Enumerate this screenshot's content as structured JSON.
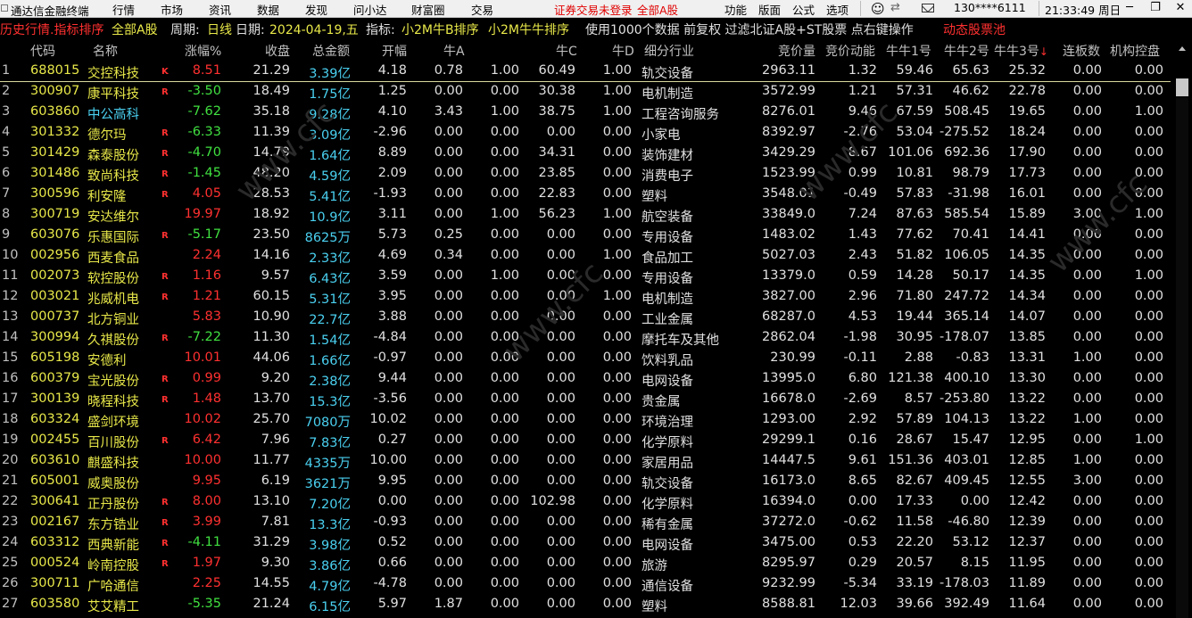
{
  "menubar": {
    "app_title": "通达信金融终端",
    "menus": [
      "行情",
      "市场",
      "资讯",
      "数据",
      "发现",
      "问小达",
      "财富圈",
      "交易"
    ],
    "trade_status": "证券交易未登录",
    "market": "全部A股",
    "right_menus": [
      "功能",
      "版面",
      "公式",
      "选项"
    ],
    "account": "130****6111",
    "clock": "21:33:49 周日",
    "win_minimize": "─",
    "win_restore": "❐",
    "win_close": "✕"
  },
  "infobar": {
    "mode": "历史行情.指标排序",
    "market": "全部A股",
    "period_label": "周期:",
    "period": "日线",
    "date_label": "日期:",
    "date": "2024-04-19,五",
    "indicator_label": "指标:",
    "indicator_b": "小2M牛B排序",
    "indicator_niu": "小2M牛牛排序",
    "data_setting": "使用1000个数据 前复权 过滤北证A股+ST股票 点右键操作",
    "pool": "动态股票池"
  },
  "columns": {
    "code": "代码",
    "name": "名称",
    "change": "涨幅%",
    "close": "收盘",
    "amount": "总金额",
    "open_pct": "开幅",
    "niu_a": "牛A",
    "niu_b": "",
    "niu_c": "牛C",
    "niu_d": "牛D",
    "industry": "细分行业",
    "bid_vol": "竞价量",
    "bid_mom": "竞价动能",
    "nn1": "牛牛1号",
    "nn2": "牛牛2号",
    "nn3": "牛牛3号",
    "sort_arrow": "↓",
    "streak": "连板数",
    "inst": "机构控盘"
  },
  "rows": [
    {
      "idx": "1",
      "code": "688015",
      "name": "交控科技",
      "badge": "K",
      "chg": "8.51",
      "close": "21.29",
      "amt": "3.39亿",
      "open": "4.18",
      "a": "0.78",
      "b": "1.00",
      "c": "60.49",
      "d": "1.00",
      "ind": "轨交设备",
      "bv": "2963.11",
      "bm": "1.32",
      "n1": "59.46",
      "n2": "65.63",
      "n3": "25.32",
      "lb": "0.00",
      "jg": "0.00"
    },
    {
      "idx": "2",
      "code": "300907",
      "name": "康平科技",
      "badge": "R",
      "chg": "-3.50",
      "close": "18.49",
      "amt": "1.75亿",
      "open": "1.25",
      "a": "0.00",
      "b": "0.00",
      "c": "30.38",
      "d": "1.00",
      "ind": "电机制造",
      "bv": "3572.99",
      "bm": "1.21",
      "n1": "57.31",
      "n2": "46.62",
      "n3": "22.78",
      "lb": "0.00",
      "jg": "0.00"
    },
    {
      "idx": "3",
      "code": "603860",
      "name": "中公高科",
      "badge": "",
      "chg": "-7.62",
      "close": "35.18",
      "amt": "9.28亿",
      "open": "4.10",
      "a": "3.43",
      "b": "1.00",
      "c": "38.75",
      "d": "1.00",
      "ind": "工程咨询服务",
      "bv": "8276.01",
      "bm": "9.46",
      "n1": "67.59",
      "n2": "508.45",
      "n3": "19.65",
      "lb": "0.00",
      "jg": "1.00"
    },
    {
      "idx": "4",
      "code": "301332",
      "name": "德尔玛",
      "badge": "R",
      "chg": "-6.33",
      "close": "11.39",
      "amt": "3.09亿",
      "open": "-2.96",
      "a": "0.00",
      "b": "0.00",
      "c": "0.00",
      "d": "0.00",
      "ind": "小家电",
      "bv": "8392.97",
      "bm": "-2.76",
      "n1": "53.04",
      "n2": "-275.52",
      "n3": "18.24",
      "lb": "0.00",
      "jg": "0.00"
    },
    {
      "idx": "5",
      "code": "301429",
      "name": "森泰股份",
      "badge": "R",
      "chg": "-4.70",
      "close": "14.79",
      "amt": "1.64亿",
      "open": "8.89",
      "a": "0.00",
      "b": "0.00",
      "c": "34.31",
      "d": "0.00",
      "ind": "装饰建材",
      "bv": "3429.29",
      "bm": "8.67",
      "n1": "101.06",
      "n2": "692.36",
      "n3": "17.90",
      "lb": "0.00",
      "jg": "0.00"
    },
    {
      "idx": "6",
      "code": "301486",
      "name": "致尚科技",
      "badge": "R",
      "chg": "-1.45",
      "close": "48.20",
      "amt": "4.59亿",
      "open": "2.09",
      "a": "0.00",
      "b": "0.00",
      "c": "23.85",
      "d": "0.00",
      "ind": "消费电子",
      "bv": "1523.99",
      "bm": "0.99",
      "n1": "10.81",
      "n2": "98.79",
      "n3": "17.73",
      "lb": "0.00",
      "jg": "0.00"
    },
    {
      "idx": "7",
      "code": "300596",
      "name": "利安隆",
      "badge": "R",
      "chg": "4.05",
      "close": "28.53",
      "amt": "5.41亿",
      "open": "-1.93",
      "a": "0.00",
      "b": "0.00",
      "c": "22.83",
      "d": "0.00",
      "ind": "塑料",
      "bv": "3548.01",
      "bm": "-0.49",
      "n1": "57.83",
      "n2": "-31.98",
      "n3": "16.01",
      "lb": "0.00",
      "jg": "0.00"
    },
    {
      "idx": "8",
      "code": "300719",
      "name": "安达维尔",
      "badge": "",
      "chg": "19.97",
      "close": "18.92",
      "amt": "10.9亿",
      "open": "3.11",
      "a": "0.00",
      "b": "1.00",
      "c": "56.23",
      "d": "1.00",
      "ind": "航空装备",
      "bv": "33849.0",
      "bm": "7.24",
      "n1": "87.63",
      "n2": "585.54",
      "n3": "15.89",
      "lb": "3.00",
      "jg": "1.00"
    },
    {
      "idx": "9",
      "code": "603076",
      "name": "乐惠国际",
      "badge": "R",
      "chg": "-5.17",
      "close": "23.50",
      "amt": "8625万",
      "open": "5.73",
      "a": "0.25",
      "b": "0.00",
      "c": "0.00",
      "d": "0.00",
      "ind": "专用设备",
      "bv": "1483.02",
      "bm": "1.43",
      "n1": "77.62",
      "n2": "70.41",
      "n3": "14.41",
      "lb": "0.00",
      "jg": "0.00"
    },
    {
      "idx": "10",
      "code": "002956",
      "name": "西麦食品",
      "badge": "",
      "chg": "2.24",
      "close": "14.16",
      "amt": "2.33亿",
      "open": "4.69",
      "a": "0.34",
      "b": "0.00",
      "c": "0.00",
      "d": "1.00",
      "ind": "食品加工",
      "bv": "5027.03",
      "bm": "2.43",
      "n1": "51.82",
      "n2": "106.05",
      "n3": "14.35",
      "lb": "0.00",
      "jg": "0.00"
    },
    {
      "idx": "11",
      "code": "002073",
      "name": "软控股份",
      "badge": "R",
      "chg": "1.16",
      "close": "9.57",
      "amt": "6.43亿",
      "open": "3.59",
      "a": "0.00",
      "b": "1.00",
      "c": "0.00",
      "d": "0.00",
      "ind": "专用设备",
      "bv": "13379.0",
      "bm": "0.59",
      "n1": "14.28",
      "n2": "50.17",
      "n3": "14.35",
      "lb": "0.00",
      "jg": "1.00"
    },
    {
      "idx": "12",
      "code": "003021",
      "name": "兆威机电",
      "badge": "R",
      "chg": "1.21",
      "close": "60.15",
      "amt": "5.31亿",
      "open": "3.95",
      "a": "0.00",
      "b": "0.00",
      "c": "0.00",
      "d": "1.00",
      "ind": "电机制造",
      "bv": "3827.00",
      "bm": "2.96",
      "n1": "71.80",
      "n2": "247.72",
      "n3": "14.34",
      "lb": "0.00",
      "jg": "0.00"
    },
    {
      "idx": "13",
      "code": "000737",
      "name": "北方铜业",
      "badge": "",
      "chg": "5.83",
      "close": "10.90",
      "amt": "22.7亿",
      "open": "3.88",
      "a": "0.00",
      "b": "0.00",
      "c": "0.00",
      "d": "0.00",
      "ind": "工业金属",
      "bv": "68287.0",
      "bm": "4.53",
      "n1": "19.44",
      "n2": "365.14",
      "n3": "14.07",
      "lb": "0.00",
      "jg": "0.00"
    },
    {
      "idx": "14",
      "code": "300994",
      "name": "久祺股份",
      "badge": "R",
      "chg": "-7.22",
      "close": "11.30",
      "amt": "1.54亿",
      "open": "-4.84",
      "a": "0.00",
      "b": "0.00",
      "c": "0.00",
      "d": "0.00",
      "ind": "摩托车及其他",
      "bv": "2862.04",
      "bm": "-1.98",
      "n1": "30.95",
      "n2": "-178.07",
      "n3": "13.85",
      "lb": "0.00",
      "jg": "0.00"
    },
    {
      "idx": "15",
      "code": "605198",
      "name": "安德利",
      "badge": "",
      "chg": "10.01",
      "close": "44.06",
      "amt": "1.66亿",
      "open": "-0.97",
      "a": "0.00",
      "b": "0.00",
      "c": "0.00",
      "d": "0.00",
      "ind": "饮料乳品",
      "bv": "230.99",
      "bm": "-0.11",
      "n1": "2.88",
      "n2": "-0.83",
      "n3": "13.31",
      "lb": "1.00",
      "jg": "0.00"
    },
    {
      "idx": "16",
      "code": "600379",
      "name": "宝光股份",
      "badge": "R",
      "chg": "0.99",
      "close": "9.20",
      "amt": "2.38亿",
      "open": "9.44",
      "a": "0.00",
      "b": "0.00",
      "c": "0.00",
      "d": "0.00",
      "ind": "电网设备",
      "bv": "13995.0",
      "bm": "6.80",
      "n1": "121.38",
      "n2": "400.10",
      "n3": "13.30",
      "lb": "0.00",
      "jg": "0.00"
    },
    {
      "idx": "17",
      "code": "300139",
      "name": "晓程科技",
      "badge": "R",
      "chg": "1.48",
      "close": "13.70",
      "amt": "15.3亿",
      "open": "-3.56",
      "a": "0.00",
      "b": "0.00",
      "c": "0.00",
      "d": "0.00",
      "ind": "贵金属",
      "bv": "16678.0",
      "bm": "-2.69",
      "n1": "8.57",
      "n2": "-253.80",
      "n3": "13.22",
      "lb": "0.00",
      "jg": "0.00"
    },
    {
      "idx": "18",
      "code": "603324",
      "name": "盛剑环境",
      "badge": "",
      "chg": "10.02",
      "close": "25.70",
      "amt": "7080万",
      "open": "10.02",
      "a": "0.00",
      "b": "0.00",
      "c": "0.00",
      "d": "0.00",
      "ind": "环境治理",
      "bv": "1293.00",
      "bm": "2.92",
      "n1": "57.89",
      "n2": "104.13",
      "n3": "13.22",
      "lb": "1.00",
      "jg": "0.00"
    },
    {
      "idx": "19",
      "code": "002455",
      "name": "百川股份",
      "badge": "R",
      "chg": "6.42",
      "close": "7.96",
      "amt": "7.83亿",
      "open": "0.27",
      "a": "0.00",
      "b": "0.00",
      "c": "0.00",
      "d": "0.00",
      "ind": "化学原料",
      "bv": "29299.1",
      "bm": "0.16",
      "n1": "28.67",
      "n2": "15.47",
      "n3": "12.95",
      "lb": "0.00",
      "jg": "1.00"
    },
    {
      "idx": "20",
      "code": "603610",
      "name": "麒盛科技",
      "badge": "",
      "chg": "10.00",
      "close": "11.77",
      "amt": "4335万",
      "open": "10.00",
      "a": "0.00",
      "b": "0.00",
      "c": "0.00",
      "d": "0.00",
      "ind": "家居用品",
      "bv": "14447.5",
      "bm": "9.61",
      "n1": "151.36",
      "n2": "403.01",
      "n3": "12.85",
      "lb": "1.00",
      "jg": "0.00"
    },
    {
      "idx": "21",
      "code": "605001",
      "name": "威奥股份",
      "badge": "",
      "chg": "9.95",
      "close": "6.19",
      "amt": "3621万",
      "open": "9.95",
      "a": "0.00",
      "b": "0.00",
      "c": "0.00",
      "d": "0.00",
      "ind": "轨交设备",
      "bv": "16173.0",
      "bm": "8.65",
      "n1": "82.67",
      "n2": "409.45",
      "n3": "12.55",
      "lb": "3.00",
      "jg": "0.00"
    },
    {
      "idx": "22",
      "code": "300641",
      "name": "正丹股份",
      "badge": "R",
      "chg": "8.00",
      "close": "13.10",
      "amt": "7.20亿",
      "open": "0.00",
      "a": "0.00",
      "b": "0.00",
      "c": "102.98",
      "d": "0.00",
      "ind": "化学原料",
      "bv": "16394.0",
      "bm": "0.00",
      "n1": "17.33",
      "n2": "0.00",
      "n3": "12.42",
      "lb": "0.00",
      "jg": "0.00"
    },
    {
      "idx": "23",
      "code": "002167",
      "name": "东方锆业",
      "badge": "R",
      "chg": "3.99",
      "close": "7.81",
      "amt": "13.3亿",
      "open": "-0.93",
      "a": "0.00",
      "b": "0.00",
      "c": "0.00",
      "d": "0.00",
      "ind": "稀有金属",
      "bv": "37272.0",
      "bm": "-0.62",
      "n1": "11.58",
      "n2": "-46.80",
      "n3": "12.39",
      "lb": "0.00",
      "jg": "0.00"
    },
    {
      "idx": "24",
      "code": "603312",
      "name": "西典新能",
      "badge": "R",
      "chg": "-4.11",
      "close": "31.29",
      "amt": "3.98亿",
      "open": "0.52",
      "a": "0.00",
      "b": "0.00",
      "c": "0.00",
      "d": "0.00",
      "ind": "电网设备",
      "bv": "3475.00",
      "bm": "0.53",
      "n1": "22.20",
      "n2": "53.12",
      "n3": "12.37",
      "lb": "0.00",
      "jg": "0.00"
    },
    {
      "idx": "25",
      "code": "000524",
      "name": "岭南控股",
      "badge": "R",
      "chg": "1.97",
      "close": "9.30",
      "amt": "3.86亿",
      "open": "0.66",
      "a": "0.00",
      "b": "0.00",
      "c": "0.00",
      "d": "0.00",
      "ind": "旅游",
      "bv": "8295.97",
      "bm": "0.29",
      "n1": "20.57",
      "n2": "8.15",
      "n3": "11.95",
      "lb": "0.00",
      "jg": "0.00"
    },
    {
      "idx": "26",
      "code": "300711",
      "name": "广哈通信",
      "badge": "",
      "chg": "2.25",
      "close": "14.55",
      "amt": "4.79亿",
      "open": "-4.78",
      "a": "0.00",
      "b": "0.00",
      "c": "0.00",
      "d": "0.00",
      "ind": "通信设备",
      "bv": "9232.99",
      "bm": "-5.34",
      "n1": "33.19",
      "n2": "-178.03",
      "n3": "11.89",
      "lb": "0.00",
      "jg": "0.00"
    },
    {
      "idx": "27",
      "code": "603580",
      "name": "艾艾精工",
      "badge": "",
      "chg": "-5.35",
      "close": "21.24",
      "amt": "6.15亿",
      "open": "5.97",
      "a": "1.87",
      "b": "0.00",
      "c": "0.00",
      "d": "0.00",
      "ind": "塑料",
      "bv": "8588.81",
      "bm": "12.03",
      "n1": "39.66",
      "n2": "392.49",
      "n3": "11.64",
      "lb": "0.00",
      "jg": "0.00"
    }
  ]
}
